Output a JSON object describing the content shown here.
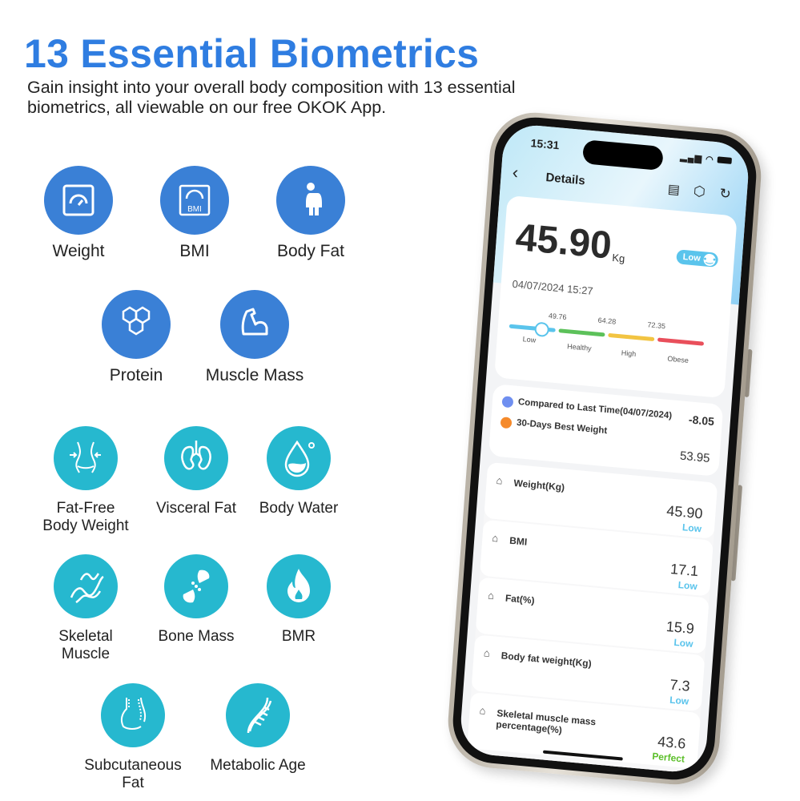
{
  "header": {
    "title": "13 Essential Biometrics",
    "subtitle": "Gain insight into your overall body composition with 13 essential biometrics, all viewable on our free OKOK App."
  },
  "colors": {
    "blue": "#3a80d6",
    "teal": "#26b8cf",
    "title": "#2f7de1",
    "low": "#5ac4ec",
    "healthy": "#5cc15a",
    "high": "#f2c442",
    "obese": "#e94f5b",
    "perfect": "#5cbf2a"
  },
  "metrics": [
    {
      "label": "Weight",
      "icon": "scale-icon"
    },
    {
      "label": "BMI",
      "icon": "bmi-gauge-icon",
      "icon_text": "BMI"
    },
    {
      "label": "Body Fat",
      "icon": "body-figure-icon"
    },
    {
      "label": "Protein",
      "icon": "hexagon-molecule-icon"
    },
    {
      "label": "Muscle Mass",
      "icon": "flexed-arm-icon"
    },
    {
      "label": "Fat-Free Body Weight",
      "icon": "waist-icon"
    },
    {
      "label": "Visceral Fat",
      "icon": "organs-icon"
    },
    {
      "label": "Body Water",
      "icon": "water-drop-icon"
    },
    {
      "label": "Skeletal Muscle",
      "icon": "muscle-fiber-icon"
    },
    {
      "label": "Bone Mass",
      "icon": "bone-joint-icon"
    },
    {
      "label": "BMR",
      "icon": "flame-icon"
    },
    {
      "label": "Subcutaneous Fat",
      "icon": "belly-icon"
    },
    {
      "label": "Metabolic Age",
      "icon": "dna-icon"
    }
  ],
  "phone": {
    "time": "15:31",
    "title": "Details",
    "weight": "45.90",
    "unit": "Kg",
    "badge": "Low",
    "datetime": "04/07/2024 15:27",
    "thresholds": [
      "49.76",
      "64.28",
      "72.35"
    ],
    "ranges": [
      "Low",
      "Healthy",
      "High",
      "Obese"
    ],
    "compare_label": "Compared to Last Time(04/07/2024)",
    "compare_value": "-8.05",
    "best_label": "30-Days Best Weight",
    "best_value": "53.95",
    "rows": [
      {
        "label": "Weight(Kg)",
        "value": "45.90",
        "status": "Low",
        "icon": "scale-icon"
      },
      {
        "label": "BMI",
        "value": "17.1",
        "status": "Low",
        "icon": "apple-icon"
      },
      {
        "label": "Fat(%)",
        "value": "15.9",
        "status": "Low",
        "icon": "torso-icon"
      },
      {
        "label": "Body fat weight(Kg)",
        "value": "7.3",
        "status": "Low",
        "icon": "torso-icon"
      },
      {
        "label": "Skeletal muscle mass percentage(%)",
        "value": "43.6",
        "status": "Perfect",
        "icon": "muscle-icon"
      }
    ]
  }
}
